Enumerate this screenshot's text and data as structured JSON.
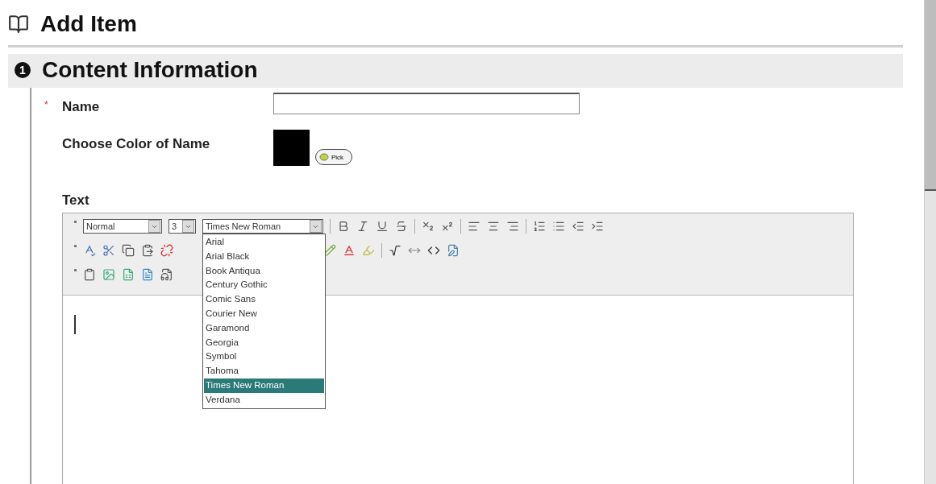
{
  "page": {
    "title": "Add Item"
  },
  "section": {
    "number": "1",
    "title": "Content Information"
  },
  "name_field": {
    "required_mark": "*",
    "label": "Name"
  },
  "color_field": {
    "label": "Choose Color of Name",
    "color": "#000000",
    "button": "Pick"
  },
  "text_field": {
    "label": "Text"
  },
  "toolbar": {
    "format": "Normal",
    "size": "3",
    "font": "Times New Roman",
    "font_options": [
      {
        "label": "Arial",
        "selected": false
      },
      {
        "label": "Arial Black",
        "selected": false
      },
      {
        "label": "Book Antiqua",
        "selected": false
      },
      {
        "label": "Century Gothic",
        "selected": false
      },
      {
        "label": "Comic Sans",
        "selected": false
      },
      {
        "label": "Courier New",
        "selected": false
      },
      {
        "label": "Garamond",
        "selected": false
      },
      {
        "label": "Georgia",
        "selected": false
      },
      {
        "label": "Symbol",
        "selected": false
      },
      {
        "label": "Tahoma",
        "selected": false
      },
      {
        "label": "Times New Roman",
        "selected": true
      },
      {
        "label": "Verdana",
        "selected": false
      }
    ]
  }
}
